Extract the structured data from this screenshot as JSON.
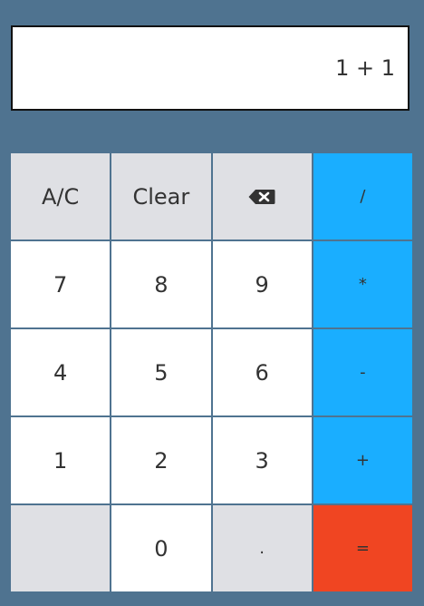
{
  "display": {
    "expression": "1 + 1"
  },
  "keys": {
    "ac": "A/C",
    "clear": "Clear",
    "backspace_icon": "backspace-icon",
    "divide": "/",
    "seven": "7",
    "eight": "8",
    "nine": "9",
    "multiply": "*",
    "four": "4",
    "five": "5",
    "six": "6",
    "minus": "-",
    "one": "1",
    "two": "2",
    "three": "3",
    "plus": "+",
    "blank": "",
    "zero": "0",
    "dot": ".",
    "equals": "="
  },
  "colors": {
    "background": "#4f7390",
    "operator": "#1aaeff",
    "equals": "#f04522",
    "function_key": "#dfe0e4",
    "digit_key": "#ffffff"
  }
}
